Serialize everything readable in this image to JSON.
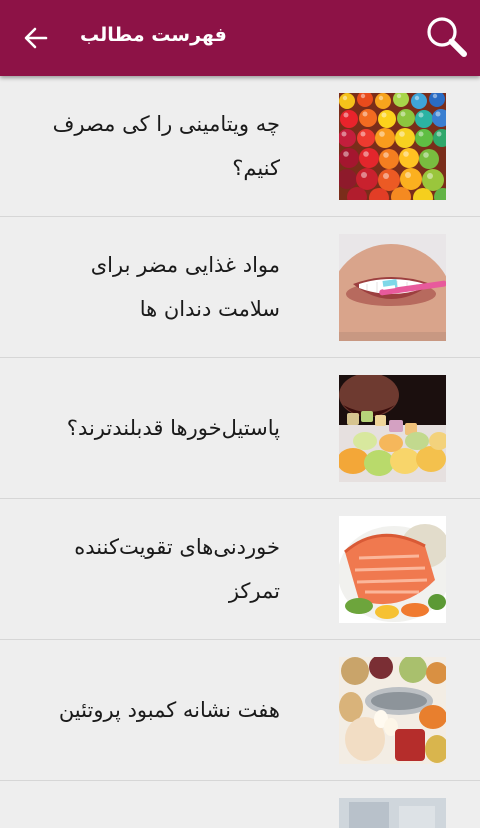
{
  "header": {
    "title": "فهرست مطالب",
    "back_icon": "arrow-back-icon",
    "search_icon": "search-icon",
    "bar_color": "#8d1246"
  },
  "articles": [
    {
      "title": "چه ویتامینی را کی مصرف کنیم؟",
      "image": "vitamin-balls-image"
    },
    {
      "title": "مواد غذایی مضر برای سلامت دندان ها",
      "image": "smile-toothbrush-image"
    },
    {
      "title": "پاستیل‌خورها قدبلندترند؟",
      "image": "gummy-candies-image"
    },
    {
      "title": "خوردنی‌های تقویت‌کننده تمرکز",
      "image": "salmon-fillet-image"
    },
    {
      "title": "هفت نشانه کمبود پروتئین",
      "image": "protein-foods-image"
    }
  ]
}
